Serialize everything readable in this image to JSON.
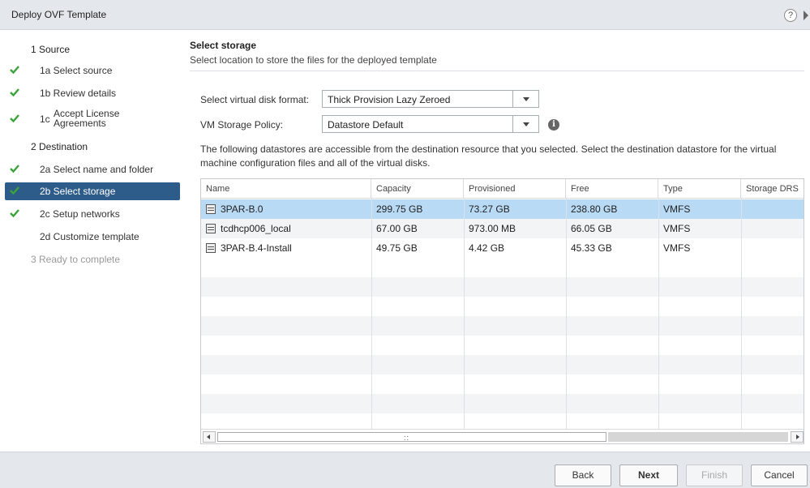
{
  "window": {
    "title": "Deploy OVF Template"
  },
  "sidebar": {
    "steps": [
      {
        "label": "1 Source"
      },
      {
        "label": "1a Select source"
      },
      {
        "label": "1b Review details"
      },
      {
        "num": "1c",
        "label_line1": "Accept License",
        "label_line2": "Agreements"
      },
      {
        "label": "2 Destination"
      },
      {
        "label": "2a Select name and folder"
      },
      {
        "label": "2b Select storage"
      },
      {
        "label": "2c Setup networks"
      },
      {
        "label": "2d Customize template"
      },
      {
        "label": "3 Ready to complete"
      }
    ]
  },
  "page": {
    "title": "Select storage",
    "subtitle": "Select location to store the files for the deployed template"
  },
  "form": {
    "disk_format_label": "Select virtual disk format:",
    "disk_format_value": "Thick Provision Lazy Zeroed",
    "policy_label": "VM Storage Policy:",
    "policy_value": "Datastore Default"
  },
  "description": "The following datastores are accessible from the destination resource that you selected. Select the destination datastore for the virtual machine configuration files and all of the virtual disks.",
  "table": {
    "columns": [
      "Name",
      "Capacity",
      "Provisioned",
      "Free",
      "Type",
      "Storage DRS"
    ],
    "rows": [
      {
        "name": "3PAR-B.0",
        "capacity": "299.75 GB",
        "provisioned": "73.27 GB",
        "free": "238.80 GB",
        "type": "VMFS",
        "drs": ""
      },
      {
        "name": "tcdhcp006_local",
        "capacity": "67.00 GB",
        "provisioned": "973.00 MB",
        "free": "66.05 GB",
        "type": "VMFS",
        "drs": ""
      },
      {
        "name": "3PAR-B.4-Install",
        "capacity": "49.75 GB",
        "provisioned": "4.42 GB",
        "free": "45.33 GB",
        "type": "VMFS",
        "drs": ""
      }
    ],
    "scroll_grip": "::"
  },
  "footer": {
    "back": "Back",
    "next": "Next",
    "finish": "Finish",
    "cancel": "Cancel"
  },
  "icons": {
    "help": "?",
    "info": "i"
  },
  "colors": {
    "accent": "#2e5c8a",
    "selected_row": "#b9daf5",
    "check": "#3aa33a"
  }
}
